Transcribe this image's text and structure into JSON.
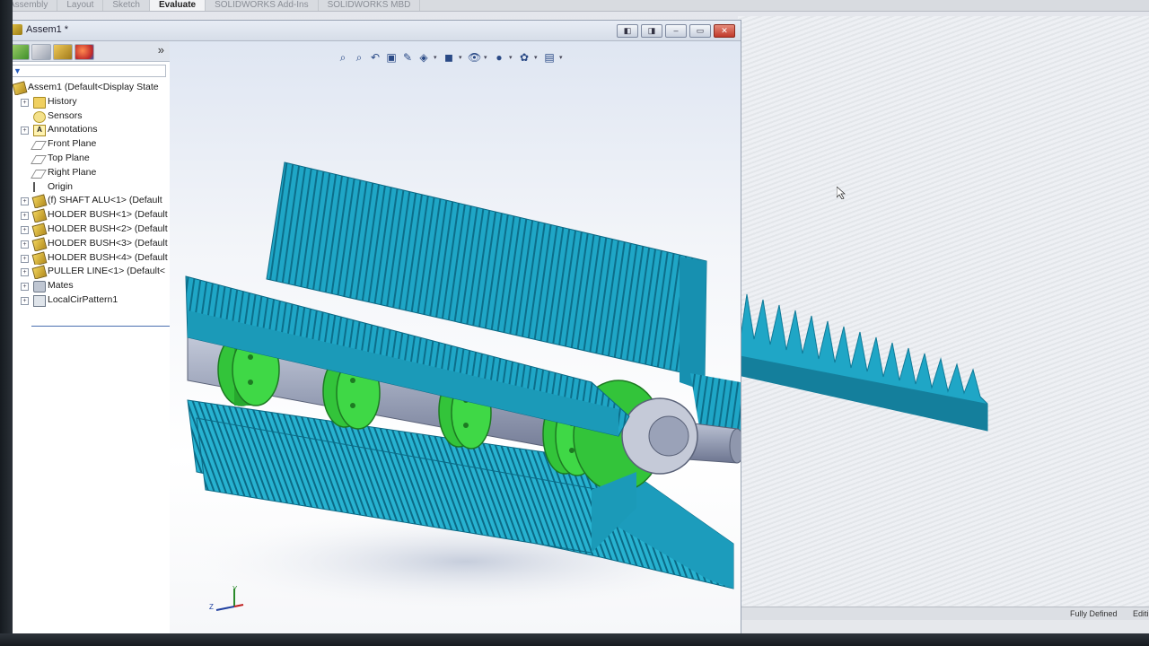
{
  "command_manager": {
    "tabs": [
      {
        "label": "Assembly",
        "active": false
      },
      {
        "label": "Layout",
        "active": false
      },
      {
        "label": "Sketch",
        "active": false
      },
      {
        "label": "Evaluate",
        "active": true
      },
      {
        "label": "SOLIDWORKS Add-Ins",
        "active": false
      },
      {
        "label": "SOLIDWORKS MBD",
        "active": false
      }
    ]
  },
  "document": {
    "title": "Assem1 *",
    "window_buttons": [
      "◧",
      "◨",
      "–",
      "▭",
      "✕"
    ]
  },
  "feature_manager": {
    "expand_glyph": "»",
    "tree": [
      {
        "label": "Assem1  (Default<Display State",
        "icon": "assembly-icon",
        "expander": "",
        "indent": 0
      },
      {
        "label": "History",
        "icon": "history-folder-icon",
        "expander": "+",
        "indent": 1
      },
      {
        "label": "Sensors",
        "icon": "sensor-icon",
        "expander": "",
        "indent": 1
      },
      {
        "label": "Annotations",
        "icon": "annotation-icon",
        "expander": "+",
        "indent": 1
      },
      {
        "label": "Front Plane",
        "icon": "plane-icon",
        "expander": "",
        "indent": 1
      },
      {
        "label": "Top Plane",
        "icon": "plane-icon",
        "expander": "",
        "indent": 1
      },
      {
        "label": "Right Plane",
        "icon": "plane-icon",
        "expander": "",
        "indent": 1
      },
      {
        "label": "Origin",
        "icon": "origin-icon",
        "expander": "",
        "indent": 1
      },
      {
        "label": "(f) SHAFT ALU<1> (Default",
        "icon": "part-icon",
        "expander": "+",
        "indent": 1
      },
      {
        "label": "HOLDER BUSH<1> (Default",
        "icon": "part-icon",
        "expander": "+",
        "indent": 1
      },
      {
        "label": "HOLDER BUSH<2> (Default",
        "icon": "part-icon",
        "expander": "+",
        "indent": 1
      },
      {
        "label": "HOLDER BUSH<3> (Default",
        "icon": "part-icon",
        "expander": "+",
        "indent": 1
      },
      {
        "label": "HOLDER BUSH<4> (Default",
        "icon": "part-icon",
        "expander": "+",
        "indent": 1
      },
      {
        "label": "PULLER LINE<1> (Default<",
        "icon": "part-icon",
        "expander": "+",
        "indent": 1
      },
      {
        "label": "Mates",
        "icon": "mates-icon",
        "expander": "+",
        "indent": 1
      },
      {
        "label": "LocalCirPattern1",
        "icon": "pattern-icon",
        "expander": "+",
        "indent": 1
      }
    ]
  },
  "heads_up_toolbar": [
    {
      "icon": "zoom-to-fit-icon",
      "glyph": "⌕"
    },
    {
      "icon": "zoom-to-area-icon",
      "glyph": "⌕"
    },
    {
      "icon": "previous-view-icon",
      "glyph": "↶"
    },
    {
      "icon": "section-view-icon",
      "glyph": "▣"
    },
    {
      "icon": "dynamic-annotation-icon",
      "glyph": "✎"
    },
    {
      "icon": "view-orientation-icon",
      "glyph": "◈"
    },
    {
      "icon": "display-style-icon",
      "glyph": "◼"
    },
    {
      "icon": "hide-show-items-icon",
      "glyph": "👁"
    },
    {
      "icon": "edit-appearance-icon",
      "glyph": "●"
    },
    {
      "icon": "apply-scene-icon",
      "glyph": "✿"
    },
    {
      "icon": "view-settings-icon",
      "glyph": "▤"
    }
  ],
  "triad": {
    "y_label": "Y",
    "z_label": "Z"
  },
  "status_bar": {
    "state": "Fully Defined",
    "mode": "Editing A"
  },
  "colors": {
    "part_cyan": "#1fa6c6",
    "part_cyan_dark": "#0f7a98",
    "bush_green": "#33c43a",
    "shaft_gray": "#9aa2b8"
  }
}
